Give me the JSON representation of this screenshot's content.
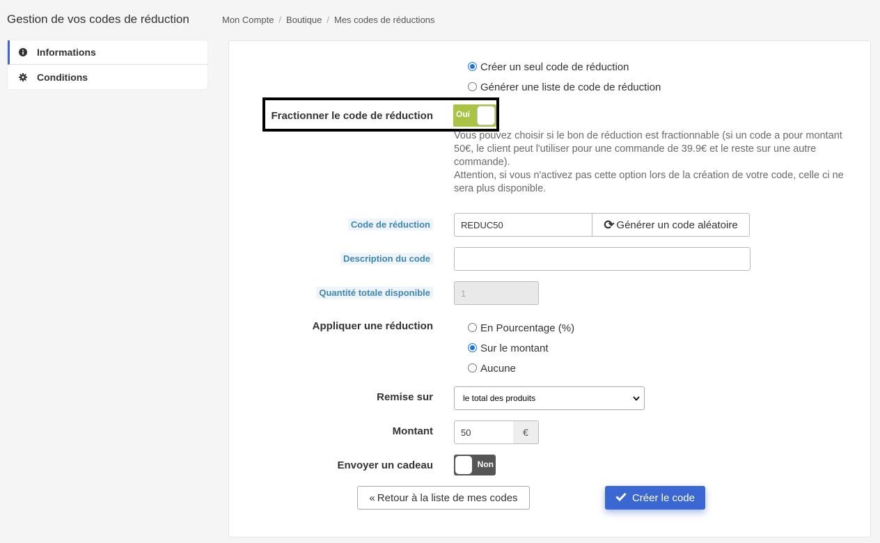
{
  "page": {
    "title": "Gestion de vos codes de réduction",
    "breadcrumb": [
      "Mon Compte",
      "Boutique",
      "Mes codes de réductions"
    ]
  },
  "sidebar": {
    "items": [
      {
        "label": "Informations",
        "icon": "info-circle-icon",
        "active": true
      },
      {
        "label": "Conditions",
        "icon": "gear-icon",
        "active": false
      }
    ]
  },
  "form": {
    "mode_options": [
      {
        "label": "Créer un seul code de réduction",
        "checked": true
      },
      {
        "label": "Générer une liste de code de réduction",
        "checked": false
      }
    ],
    "split": {
      "label": "Fractionner le code de réduction",
      "toggle_text": "Oui",
      "enabled": true,
      "help_1": "Vous pouvez choisir si le bon de réduction est fractionnable (si un code a pour montant 50€, le client peut l'utiliser pour une commande de 39.9€ et le reste sur une autre commande).",
      "help_2": "Attention, si vous n'activez pas cette option lors de la création de votre code, celle ci ne sera plus disponible."
    },
    "code": {
      "label": "Code de réduction",
      "value": "REDUC50",
      "generate_label": "Générer un code aléatoire"
    },
    "description": {
      "label": "Description du code",
      "value": ""
    },
    "quantity": {
      "label": "Quantité totale disponible",
      "value": "1"
    },
    "discount": {
      "label": "Appliquer une réduction",
      "options": [
        {
          "label": "En Pourcentage (%)",
          "checked": false
        },
        {
          "label": "Sur le montant",
          "checked": true
        },
        {
          "label": "Aucune",
          "checked": false
        }
      ]
    },
    "remise": {
      "label": "Remise sur",
      "selected": "le total des produits"
    },
    "amount": {
      "label": "Montant",
      "value": "50",
      "currency": "€"
    },
    "gift": {
      "label": "Envoyer un cadeau",
      "toggle_text": "Non",
      "enabled": false
    },
    "buttons": {
      "back_label": "Retour à la liste de mes codes",
      "create_label": "Créer le code"
    }
  },
  "colors": {
    "primary": "#3a67d1",
    "toggle_on": "#a9c344",
    "toggle_off": "#555555",
    "label_chip": "#3d87b5"
  }
}
